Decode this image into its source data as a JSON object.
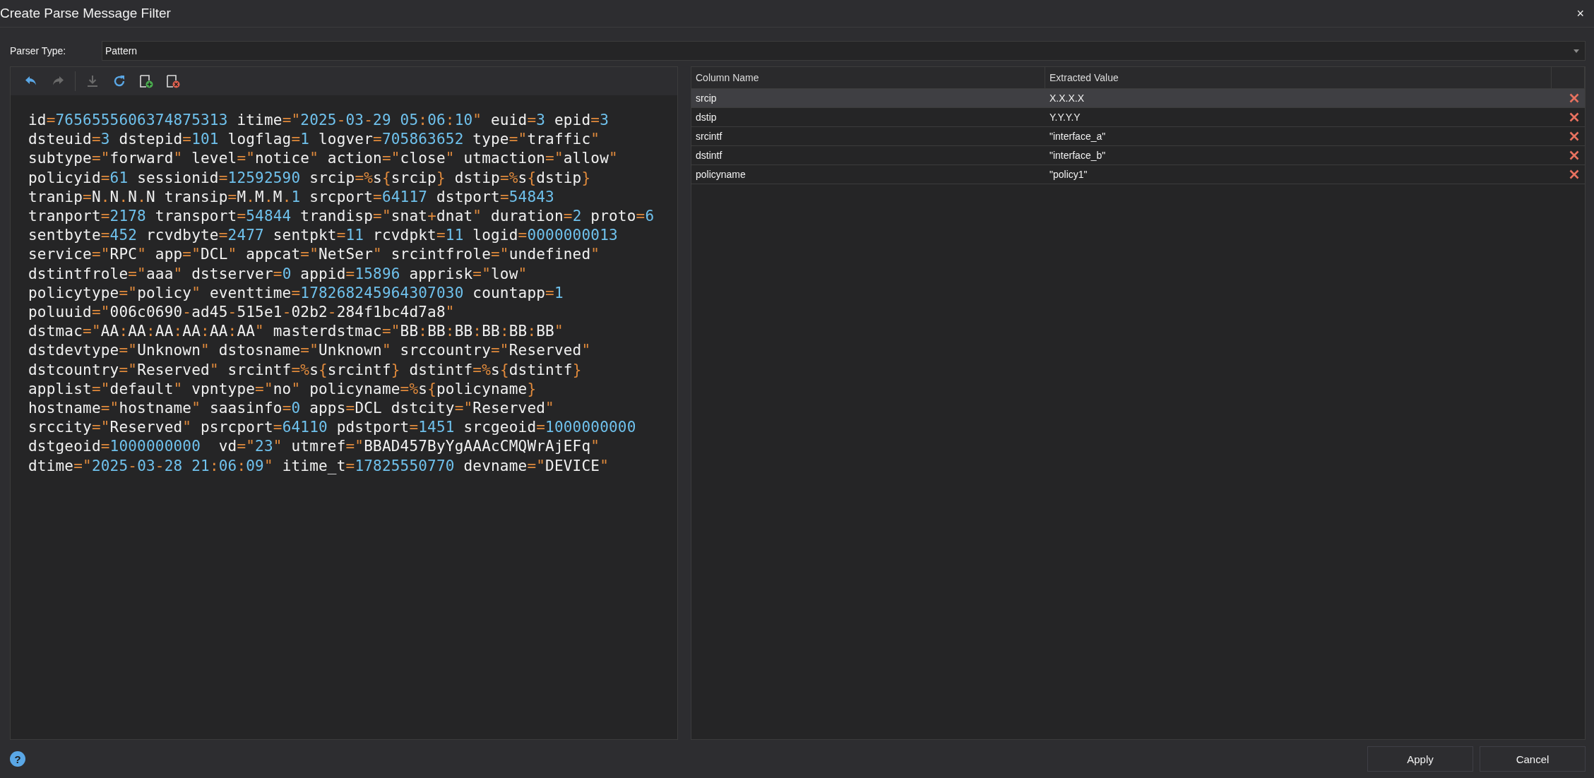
{
  "window": {
    "title": "Create Parse Message Filter",
    "close": "×"
  },
  "parser_type": {
    "label": "Parser Type:",
    "value": "Pattern"
  },
  "toolbar": [
    {
      "kind": "undo",
      "disabled": false
    },
    {
      "kind": "redo",
      "disabled": true
    },
    {
      "kind": "separator"
    },
    {
      "kind": "download",
      "disabled": true
    },
    {
      "kind": "refresh",
      "disabled": false
    },
    {
      "kind": "add",
      "disabled": false
    },
    {
      "kind": "remove",
      "disabled": false
    }
  ],
  "editor": {
    "lines": [
      "id=7656555606374875313 itime=\"2025-03-29 05:06:10\" euid=3 epid=3",
      "dsteuid=3 dstepid=101 logflag=1 logver=705863652 type=\"traffic\"",
      "subtype=\"forward\" level=\"notice\" action=\"close\" utmaction=\"allow\"",
      "policyid=61 sessionid=12592590 srcip=%s{srcip} dstip=%s{dstip}",
      "tranip=N.N.N.N transip=M.M.M.1 srcport=64117 dstport=54843",
      "tranport=2178 transport=54844 trandisp=\"snat+dnat\" duration=2 proto=6",
      "sentbyte=452 rcvdbyte=2477 sentpkt=11 rcvdpkt=11 logid=0000000013",
      "service=\"RPC\" app=\"DCL\" appcat=\"NetSer\" srcintfrole=\"undefined\"",
      "dstintfrole=\"aaa\" dstserver=0 appid=15896 apprisk=\"low\"",
      "policytype=\"policy\" eventtime=178268245964307030 countapp=1",
      "poluuid=\"006c0690-ad45-515e1-02b2-284f1bc4d7a8\"",
      "dstmac=\"AA:AA:AA:AA:AA:AA\" masterdstmac=\"BB:BB:BB:BB:BB:BB\"",
      "dstdevtype=\"Unknown\" dstosname=\"Unknown\" srccountry=\"Reserved\"",
      "dstcountry=\"Reserved\" srcintf=%s{srcintf} dstintf=%s{dstintf}",
      "applist=\"default\" vpntype=\"no\" policyname=%s{policyname}",
      "hostname=\"hostname\" saasinfo=0 apps=DCL dstcity=\"Reserved\"",
      "srccity=\"Reserved\" psrcport=64110 pdstport=1451 srcgeoid=1000000000",
      "dstgeoid=1000000000  vd=\"23\" utmref=\"BBAD457ByYgAAAcCMQWrAjEFq\"",
      "dtime=\"2025-03-28 21:06:09\" itime_t=17825550770 devname=\"DEVICE\""
    ]
  },
  "table": {
    "columns": [
      "Column Name",
      "Extracted Value"
    ],
    "rows": [
      {
        "name": "srcip",
        "value": "X.X.X.X",
        "selected": true
      },
      {
        "name": "dstip",
        "value": "Y.Y.Y.Y",
        "selected": false
      },
      {
        "name": "srcintf",
        "value": "\"interface_a\"",
        "selected": false
      },
      {
        "name": "dstintf",
        "value": "\"interface_b\"",
        "selected": false
      },
      {
        "name": "policyname",
        "value": "\"policy1\"",
        "selected": false
      }
    ]
  },
  "help": "?",
  "buttons": [
    "Apply",
    "Cancel"
  ]
}
